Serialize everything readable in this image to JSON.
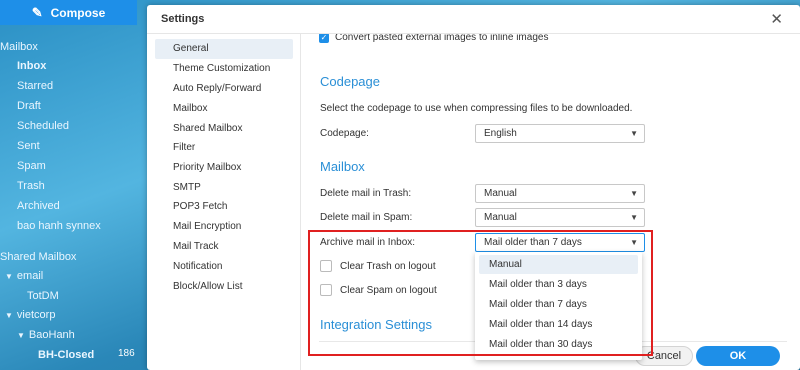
{
  "compose": {
    "label": "Compose",
    "icon": "pencil-icon"
  },
  "mail_nav": {
    "mailbox_heading": "Mailbox",
    "folders": [
      "Inbox",
      "Starred",
      "Draft",
      "Scheduled",
      "Sent",
      "Spam",
      "Trash",
      "Archived",
      "bao hanh synnex"
    ],
    "shared_heading": "Shared Mailbox",
    "shared": [
      {
        "label": "email"
      },
      {
        "label": "TotDM"
      },
      {
        "label": "vietcorp"
      },
      {
        "label": "BaoHanh"
      },
      {
        "label": "BH-Closed",
        "count": "186"
      }
    ]
  },
  "dialog": {
    "title": "Settings",
    "close_symbol": "✕",
    "nav": [
      "General",
      "Theme Customization",
      "Auto Reply/Forward",
      "Mailbox",
      "Shared Mailbox",
      "Filter",
      "Priority Mailbox",
      "SMTP",
      "POP3 Fetch",
      "Mail Encryption",
      "Mail Track",
      "Notification",
      "Block/Allow List"
    ],
    "active_nav": "General"
  },
  "content": {
    "truncated_option": "Convert pasted external images to inline images",
    "codepage": {
      "heading": "Codepage",
      "description": "Select the codepage to use when compressing files to be downloaded.",
      "label": "Codepage:",
      "value": "English"
    },
    "mailbox": {
      "heading": "Mailbox",
      "trash_label": "Delete mail in Trash:",
      "trash_value": "Manual",
      "spam_label": "Delete mail in Spam:",
      "spam_value": "Manual",
      "archive_label": "Archive mail in Inbox:",
      "archive_value": "Mail older than 7 days",
      "clear_trash": "Clear Trash on logout",
      "clear_spam": "Clear Spam on logout"
    },
    "integration_heading": "Integration Settings",
    "archive_options": [
      "Manual",
      "Mail older than 3 days",
      "Mail older than 7 days",
      "Mail older than 14 days",
      "Mail older than 30 days"
    ]
  },
  "footer": {
    "cancel": "Cancel",
    "ok": "OK"
  },
  "colors": {
    "accent": "#1e8fe8",
    "heading": "#2a8fd6",
    "highlight_box": "#e02020"
  }
}
